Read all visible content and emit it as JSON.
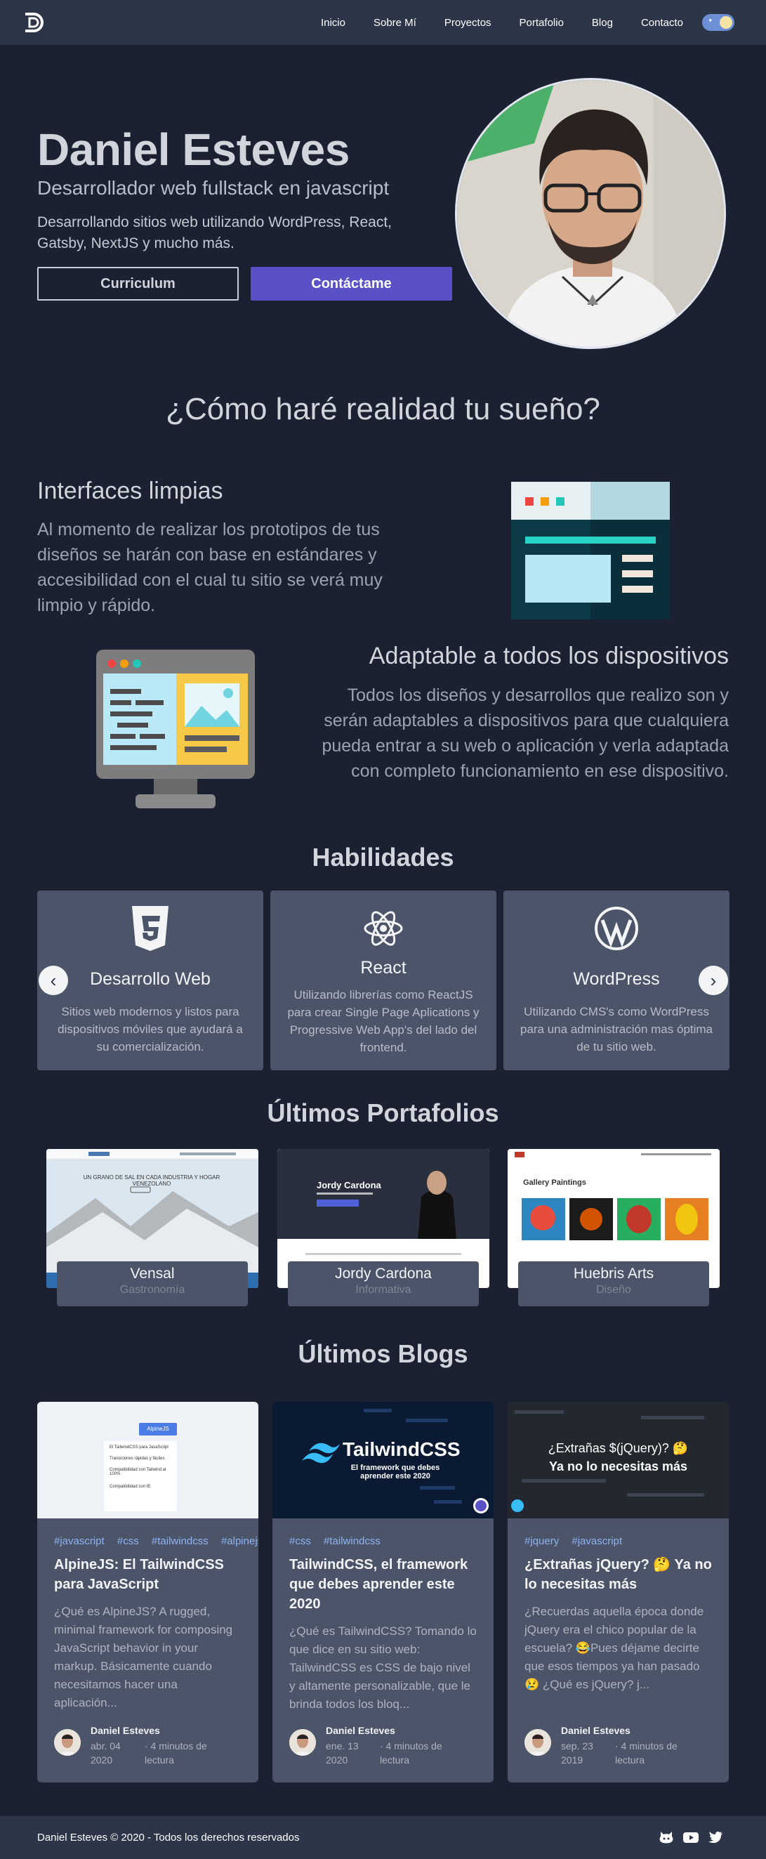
{
  "nav": {
    "logo_icon": "brand-logo-icon",
    "links": [
      "Inicio",
      "Sobre Mí",
      "Proyectos",
      "Portafolio",
      "Blog",
      "Contacto"
    ],
    "theme_toggle_icon": "theme-toggle-icon"
  },
  "hero": {
    "name": "Daniel Esteves",
    "role": "Desarrollador web fullstack en javascript",
    "description": "Desarrollando sitios web utilizando WordPress, React, Gatsby, NextJS y mucho más.",
    "cv_button": "Curriculum",
    "contact_button": "Contáctame"
  },
  "how": {
    "title": "¿Cómo haré realidad tu sueño?",
    "features": [
      {
        "title": "Interfaces limpias",
        "text": "Al momento de realizar los prototipos de tus diseños se harán con base en estándares y accesibilidad con el cual tu sitio se verá muy limpio y rápido."
      },
      {
        "title": "Adaptable a todos los dispositivos",
        "text": "Todos los diseños y desarrollos que realizo son y serán adaptables a dispositivos para que cualquiera pueda entrar a su web o aplicación y verla adaptada con completo funcionamiento en ese dispositivo."
      }
    ]
  },
  "skills": {
    "title": "Habilidades",
    "items": [
      {
        "title": "Desarrollo Web",
        "text": "Sitios web modernos y listos para dispositivos móviles que ayudará a su comercialización.",
        "icon": "html5-icon"
      },
      {
        "title": "React",
        "text": "Utilizando librerías como ReactJS para crear Single Page Aplications y Progressive Web App's del lado del frontend.",
        "icon": "react-icon"
      },
      {
        "title": "WordPress",
        "text": "Utilizando CMS's como WordPress para una administración mas óptima de tu sitio web.",
        "icon": "wordpress-icon"
      }
    ],
    "prev_icon": "chevron-left-icon",
    "next_icon": "chevron-right-icon"
  },
  "portfolio": {
    "title": "Últimos Portafolios",
    "items": [
      {
        "name": "Vensal",
        "category": "Gastronomía",
        "thumb_text": "UN GRANO DE SAL EN CADA INDUSTRIA Y HOGAR VENEZOLANO"
      },
      {
        "name": "Jordy Cardona",
        "category": "Informativa",
        "thumb_text": "Jordy Cardona"
      },
      {
        "name": "Huebris Arts",
        "category": "Diseño",
        "thumb_text": "Gallery Paintings"
      }
    ]
  },
  "blogs": {
    "title": "Últimos Blogs",
    "items": [
      {
        "tags": [
          "#javascript",
          "#css",
          "#tailwindcss",
          "#alpinejs"
        ],
        "title": "AlpineJS: El TailwindCSS para JavaScript",
        "excerpt": "¿Qué es AlpineJS? A rugged, minimal framework for composing JavaScript behavior in your markup. Básicamente cuando necesitamos hacer una aplicación...",
        "author": "Daniel Esteves",
        "date": "abr. 04 2020",
        "read": "· 4 minutos de lectura",
        "thumb_label": "AlpineJS",
        "thumb_items": [
          "El TailwindCSS para JavaScript",
          "Transiciones rápidas y fáciles",
          "Compatibilidad con Tailwind al 100%",
          "Compatibilidad con IE"
        ]
      },
      {
        "tags": [
          "#css",
          "#tailwindcss"
        ],
        "title": "TailwindCSS, el framework que debes aprender este 2020",
        "excerpt": "¿Qué es TailwindCSS? Tomando lo que dice en su sitio web: TailwindCSS es CSS de bajo nivel y altamente personalizable, que le brinda todos los bloq...",
        "author": "Daniel Esteves",
        "date": "ene. 13 2020",
        "read": "· 4 minutos de lectura",
        "thumb_label": "TailwindCSS",
        "thumb_sub": "El framework que debes aprender este 2020"
      },
      {
        "tags": [
          "#jquery",
          "#javascript"
        ],
        "title": "¿Extrañas jQuery? 🤔 Ya no lo necesitas más",
        "excerpt": "¿Recuerdas aquella época donde jQuery era el chico popular de la escuela? 😂Pues déjame decirte que esos tiempos ya han pasado 😢 ¿Qué es jQuery? j...",
        "author": "Daniel Esteves",
        "date": "sep. 23 2019",
        "read": "· 4 minutos de lectura",
        "thumb_label": "¿Extrañas $(jQuery)? 🤔",
        "thumb_sub": "Ya no lo necesitas más"
      }
    ]
  },
  "footer": {
    "text": "Daniel Esteves © 2020 - Todos los derechos reservados",
    "icons": [
      "github-icon",
      "youtube-icon",
      "twitter-icon"
    ]
  }
}
